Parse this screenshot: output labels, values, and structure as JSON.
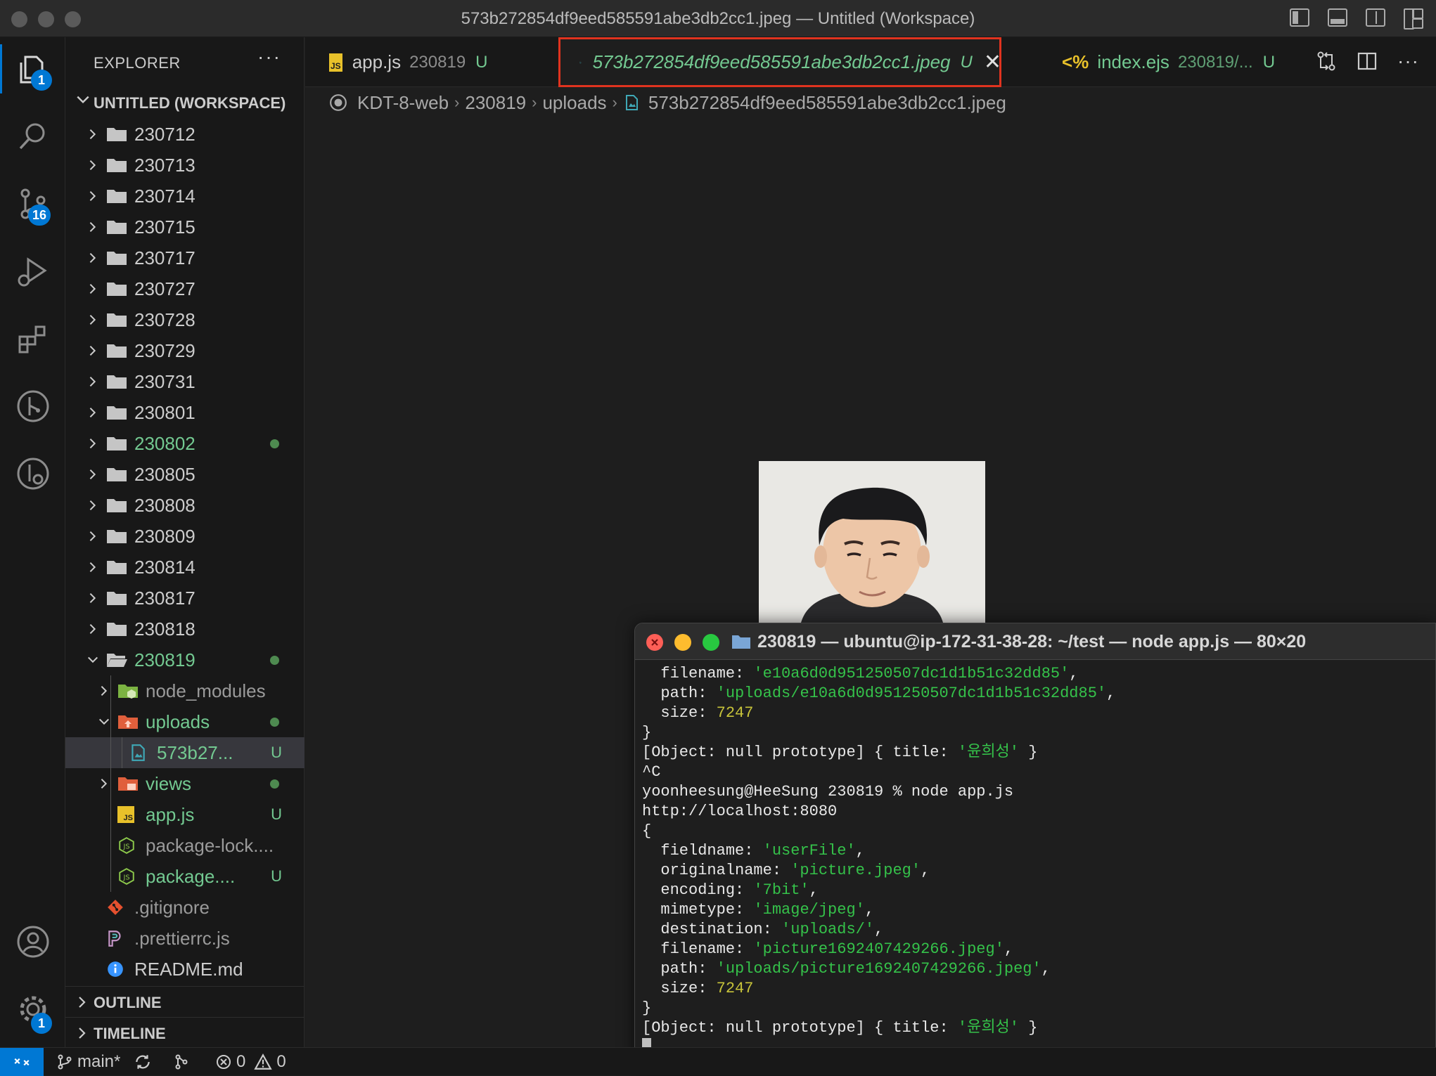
{
  "window": {
    "title": "573b272854df9eed585591abe3db2cc1.jpeg — Untitled (Workspace)"
  },
  "activity_bar": {
    "explorer_badge": "1",
    "scm_badge": "16",
    "settings_badge": "1"
  },
  "sidebar": {
    "header": "EXPLORER",
    "more": "···",
    "workspace_label": "UNTITLED (WORKSPACE)",
    "items": [
      {
        "label": "230712"
      },
      {
        "label": "230713"
      },
      {
        "label": "230714"
      },
      {
        "label": "230715"
      },
      {
        "label": "230717"
      },
      {
        "label": "230727"
      },
      {
        "label": "230728"
      },
      {
        "label": "230729"
      },
      {
        "label": "230731"
      },
      {
        "label": "230801"
      },
      {
        "label": "230802"
      },
      {
        "label": "230805"
      },
      {
        "label": "230808"
      },
      {
        "label": "230809"
      },
      {
        "label": "230814"
      },
      {
        "label": "230817"
      },
      {
        "label": "230818"
      },
      {
        "label": "230819"
      },
      {
        "label": "node_modules"
      },
      {
        "label": "uploads"
      },
      {
        "label": "573b27...",
        "status": "U"
      },
      {
        "label": "views"
      },
      {
        "label": "app.js",
        "status": "U"
      },
      {
        "label": "package-lock...."
      },
      {
        "label": "package....",
        "status": "U"
      },
      {
        "label": ".gitignore"
      },
      {
        "label": ".prettierrc.js"
      },
      {
        "label": "README.md"
      }
    ],
    "outline_label": "OUTLINE",
    "timeline_label": "TIMELINE"
  },
  "tabs": [
    {
      "label": "app.js",
      "sub": "230819",
      "status": "U"
    },
    {
      "label": "573b272854df9eed585591abe3db2cc1.jpeg",
      "status": "U"
    },
    {
      "label": "index.ejs",
      "sub": "230819/...",
      "status": "U"
    }
  ],
  "breadcrumb": {
    "items": [
      "KDT-8-web",
      "230819",
      "uploads",
      "573b272854df9eed585591abe3db2cc1.jpeg"
    ]
  },
  "terminal": {
    "title": "230819 — ubuntu@ip-172-31-38-28: ~/test — node app.js — 80×20",
    "lines": [
      {
        "k": "  filename: ",
        "v": "'e10a6d0d951250507dc1d1b51c32dd85'",
        "t": "s",
        "e": ","
      },
      {
        "k": "  path: ",
        "v": "'uploads/e10a6d0d951250507dc1d1b51c32dd85'",
        "t": "s",
        "e": ","
      },
      {
        "k": "  size: ",
        "v": "7247",
        "t": "n",
        "e": ""
      },
      {
        "k": "}",
        "v": "",
        "t": "",
        "e": ""
      },
      {
        "k": "[Object: null prototype] { title: ",
        "v": "'윤희성'",
        "t": "s",
        "e": " }"
      },
      {
        "k": "^C",
        "v": "",
        "t": "",
        "e": ""
      },
      {
        "k": "yoonheesung@HeeSung 230819 % node app.js",
        "v": "",
        "t": "",
        "e": ""
      },
      {
        "k": "http://localhost:8080",
        "v": "",
        "t": "",
        "e": ""
      },
      {
        "k": "{",
        "v": "",
        "t": "",
        "e": ""
      },
      {
        "k": "  fieldname: ",
        "v": "'userFile'",
        "t": "s",
        "e": ","
      },
      {
        "k": "  originalname: ",
        "v": "'picture.jpeg'",
        "t": "s",
        "e": ","
      },
      {
        "k": "  encoding: ",
        "v": "'7bit'",
        "t": "s",
        "e": ","
      },
      {
        "k": "  mimetype: ",
        "v": "'image/jpeg'",
        "t": "s",
        "e": ","
      },
      {
        "k": "  destination: ",
        "v": "'uploads/'",
        "t": "s",
        "e": ","
      },
      {
        "k": "  filename: ",
        "v": "'picture1692407429266.jpeg'",
        "t": "s",
        "e": ","
      },
      {
        "k": "  path: ",
        "v": "'uploads/picture1692407429266.jpeg'",
        "t": "s",
        "e": ","
      },
      {
        "k": "  size: ",
        "v": "7247",
        "t": "n",
        "e": ""
      },
      {
        "k": "}",
        "v": "",
        "t": "",
        "e": ""
      },
      {
        "k": "[Object: null prototype] { title: ",
        "v": "'윤희성'",
        "t": "s",
        "e": " }"
      }
    ]
  },
  "statusbar": {
    "branch": "main*",
    "errors": "0",
    "warnings": "0"
  },
  "colors": {
    "accent": "#0078d4",
    "git_untracked": "#73c991",
    "highlight_box": "#e0331f",
    "terminal_string": "#35c24a",
    "terminal_number": "#c8c43a"
  }
}
